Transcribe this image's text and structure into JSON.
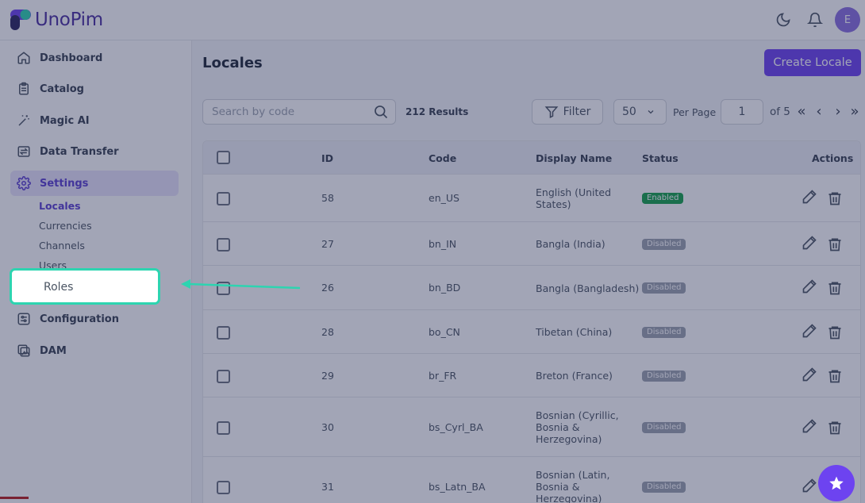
{
  "header": {
    "logo_text": "UnoPim",
    "avatar_initial": "E"
  },
  "sidebar": {
    "items": [
      {
        "label": "Dashboard",
        "icon": "home-icon"
      },
      {
        "label": "Catalog",
        "icon": "clipboard-icon"
      },
      {
        "label": "Magic AI",
        "icon": "magic-wand-icon"
      },
      {
        "label": "Data Transfer",
        "icon": "transfer-icon"
      },
      {
        "label": "Settings",
        "icon": "gear-icon"
      },
      {
        "label": "Configuration",
        "icon": "sliders-icon"
      },
      {
        "label": "DAM",
        "icon": "images-icon"
      }
    ],
    "settings_sub": [
      "Locales",
      "Currencies",
      "Channels",
      "Users",
      "Roles"
    ]
  },
  "main": {
    "title": "Locales",
    "create_label": "Create Locale",
    "search_placeholder": "Search by code",
    "results": "212 Results",
    "filter_label": "Filter",
    "per_page_value": "50",
    "per_page_label": "Per Page",
    "page_value": "1",
    "of_label": "of 5",
    "pager": {
      "first": "«",
      "prev": "‹",
      "next": "›",
      "last": "»"
    }
  },
  "table": {
    "headers": {
      "id": "ID",
      "code": "Code",
      "display_name": "Display Name",
      "status": "Status",
      "actions": "Actions"
    },
    "rows": [
      {
        "id": "58",
        "code": "en_US",
        "name": [
          "English (United",
          "States)"
        ],
        "status": "Enabled"
      },
      {
        "id": "27",
        "code": "bn_IN",
        "name": [
          "Bangla (India)"
        ],
        "status": "Disabled"
      },
      {
        "id": "26",
        "code": "bn_BD",
        "name": [
          "Bangla (Bangladesh)"
        ],
        "status": "Disabled"
      },
      {
        "id": "28",
        "code": "bo_CN",
        "name": [
          "Tibetan (China)"
        ],
        "status": "Disabled"
      },
      {
        "id": "29",
        "code": "br_FR",
        "name": [
          "Breton (France)"
        ],
        "status": "Disabled"
      },
      {
        "id": "30",
        "code": "bs_Cyrl_BA",
        "name": [
          "Bosnian (Cyrillic,",
          "Bosnia &",
          "Herzegovina)"
        ],
        "status": "Disabled"
      },
      {
        "id": "31",
        "code": "bs_Latn_BA",
        "name": [
          "Bosnian (Latin,",
          "Bosnia &",
          "Herzegovina)"
        ],
        "status": "Disabled"
      }
    ]
  },
  "highlight": {
    "label": "Roles"
  },
  "colors": {
    "accent": "#6d43f0",
    "highlight": "#2dd4b0",
    "enabled": "#16a34a",
    "disabled": "#9ca3af"
  }
}
